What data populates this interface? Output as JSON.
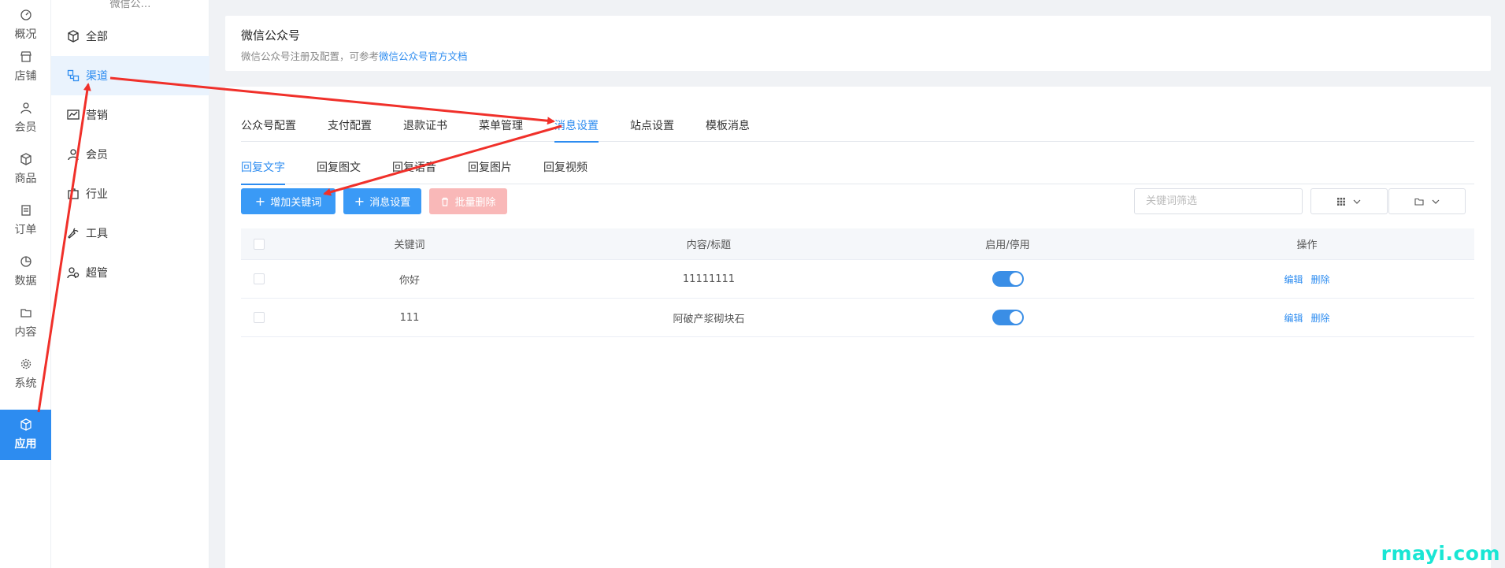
{
  "rail": {
    "items": [
      {
        "label": "概况",
        "icon": "dashboard-icon"
      },
      {
        "label": "店铺",
        "icon": "shop-icon"
      },
      {
        "label": "会员",
        "icon": "user-icon"
      },
      {
        "label": "商品",
        "icon": "box-icon"
      },
      {
        "label": "订单",
        "icon": "order-icon"
      },
      {
        "label": "数据",
        "icon": "pie-chart-icon"
      },
      {
        "label": "内容",
        "icon": "folder-icon"
      },
      {
        "label": "系统",
        "icon": "gear-icon"
      },
      {
        "label": "应用",
        "icon": "cube-icon",
        "active": true
      }
    ]
  },
  "submenu": {
    "title": "微信公…",
    "items": [
      {
        "label": "全部",
        "icon": "cube-outline-icon"
      },
      {
        "label": "渠道",
        "icon": "channel-icon",
        "active": true
      },
      {
        "label": "营销",
        "icon": "marketing-chart-icon"
      },
      {
        "label": "会员",
        "icon": "member-icon"
      },
      {
        "label": "行业",
        "icon": "industry-icon"
      },
      {
        "label": "工具",
        "icon": "wrench-icon"
      },
      {
        "label": "超管",
        "icon": "admin-user-icon"
      }
    ]
  },
  "header": {
    "title": "微信公众号",
    "desc_prefix": "微信公众号注册及配置，可参考",
    "doc_link": "微信公众号官方文档"
  },
  "tabs": [
    "公众号配置",
    "支付配置",
    "退款证书",
    "菜单管理",
    "消息设置",
    "站点设置",
    "模板消息"
  ],
  "active_tab": "消息设置",
  "subtabs": [
    "回复文字",
    "回复图文",
    "回复语音",
    "回复图片",
    "回复视频"
  ],
  "active_subtab": "回复文字",
  "actions": {
    "add_keyword": "增加关键词",
    "message_settings": "消息设置",
    "batch_delete": "批量删除"
  },
  "filter": {
    "placeholder": "关键词筛选"
  },
  "table": {
    "headers": {
      "keyword": "关键词",
      "content": "内容/标题",
      "status": "启用/停用",
      "ops": "操作"
    },
    "rows": [
      {
        "keyword": "你好",
        "content": "11111111",
        "enabled": true,
        "edit": "编辑",
        "delete": "删除"
      },
      {
        "keyword": "111",
        "content": "阿破产浆砌块石",
        "enabled": true,
        "edit": "编辑",
        "delete": "删除"
      }
    ]
  },
  "watermark": "rmayi.com",
  "colors": {
    "primary": "#2d8cf0",
    "annotation_arrow": "#f0302a",
    "disabled_red": "#f9b8b8",
    "watermark": "#19e6d4"
  }
}
